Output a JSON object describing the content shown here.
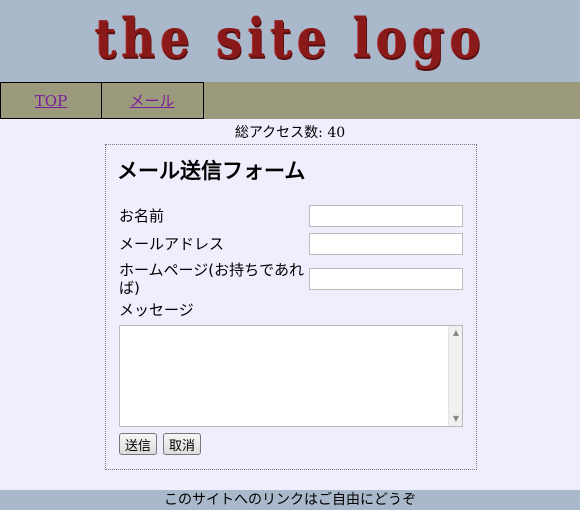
{
  "header": {
    "logo_text": "the site logo"
  },
  "nav": {
    "items": [
      {
        "label": "TOP"
      },
      {
        "label": "メール"
      }
    ]
  },
  "counter": {
    "text": "総アクセス数: 40"
  },
  "form": {
    "title": "メール送信フォーム",
    "name_label": "お名前",
    "name_value": "",
    "email_label": "メールアドレス",
    "email_value": "",
    "homepage_label_line1": "ホームページ(お持ちであれ",
    "homepage_label_line2": "ば)",
    "homepage_value": "",
    "message_label": "メッセージ",
    "message_value": "",
    "submit_label": "送信",
    "cancel_label": "取消"
  },
  "footer": {
    "text": "このサイトへのリンクはご自由にどうぞ"
  },
  "colors": {
    "header_bg": "#a9b8cb",
    "nav_bg": "#9c9a7c",
    "page_bg": "#eeeefd",
    "logo": "#8a1a1a",
    "link": "#7b1e9a"
  }
}
